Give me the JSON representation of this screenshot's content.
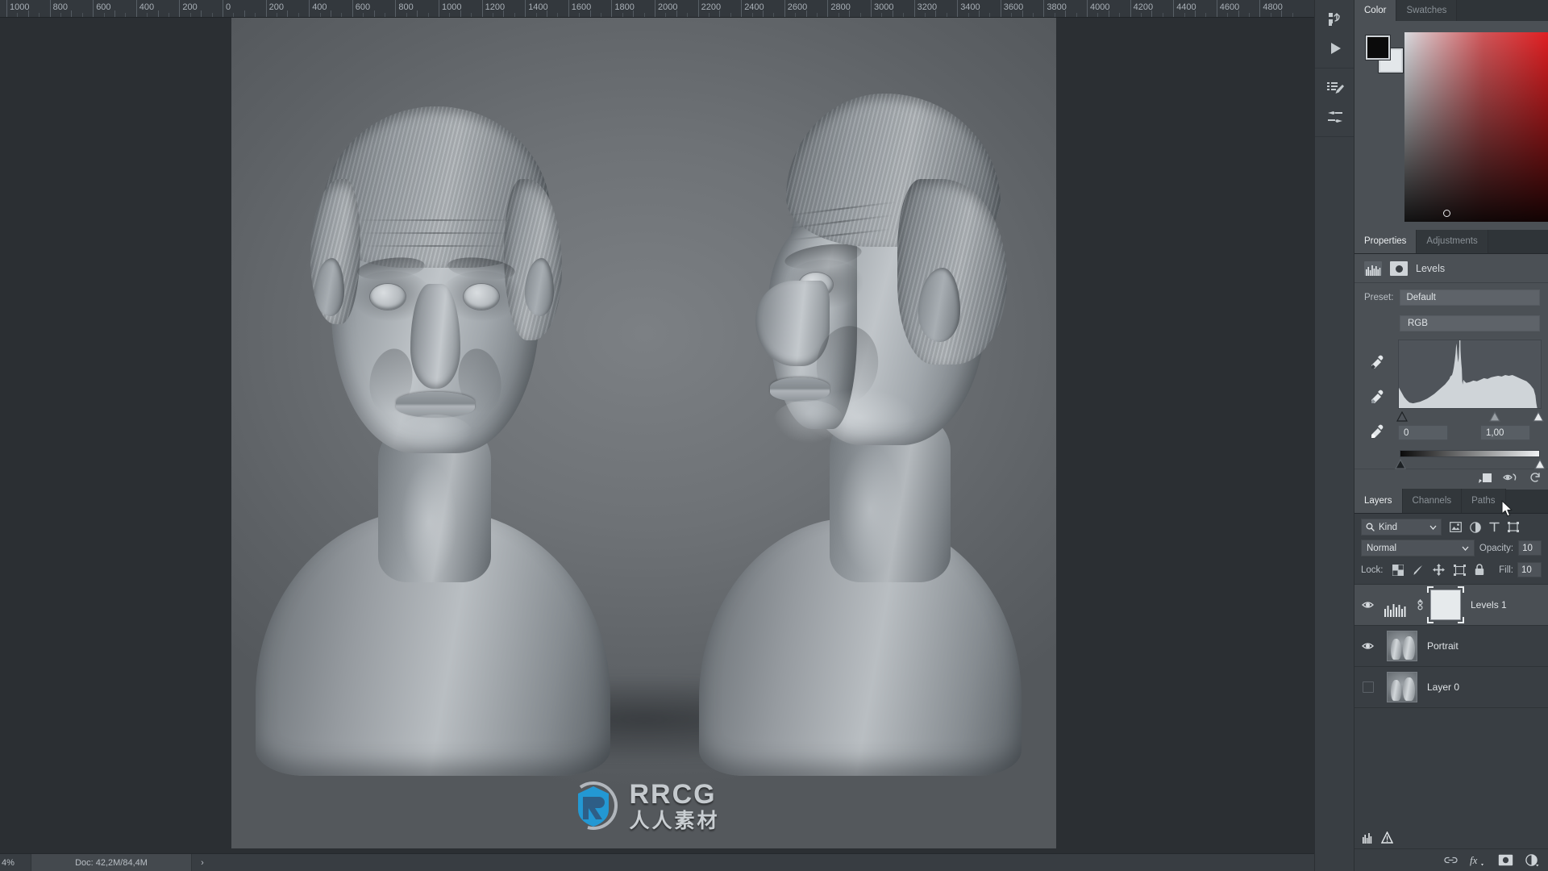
{
  "ruler": {
    "unit_step": 200,
    "labels": [
      "1000",
      "800",
      "600",
      "400",
      "200",
      "0",
      "200",
      "400",
      "600",
      "800",
      "1000",
      "1200",
      "1400",
      "1600",
      "1800",
      "2000",
      "2200",
      "2400",
      "2600",
      "2800",
      "3000",
      "3200",
      "3400",
      "3600",
      "3800",
      "4000",
      "4200",
      "4400",
      "4600",
      "4800"
    ]
  },
  "statusbar": {
    "zoom": "4%",
    "doc": "Doc: 42,2M/84,4M",
    "arrow": "›"
  },
  "watermark": {
    "main": "RRCG",
    "sub": "人人素材",
    "badge": "rrcg-logo-icon"
  },
  "rail": {
    "items": [
      {
        "name": "history-actions-icon",
        "label": "History / Actions"
      },
      {
        "name": "play-icon",
        "label": "Play"
      },
      {
        "name": "brush-presets-icon",
        "label": "Brush Presets"
      },
      {
        "name": "brush-settings-icon",
        "label": "Brush Settings"
      }
    ]
  },
  "color_panel": {
    "tabs": [
      {
        "label": "Color",
        "active": true
      },
      {
        "label": "Swatches",
        "active": false
      }
    ],
    "foreground": "#0b0b0b",
    "background": "#e3e7ea",
    "ramp_accent": "#e01f22"
  },
  "properties": {
    "tabs": [
      {
        "label": "Properties",
        "active": true
      },
      {
        "label": "Adjustments",
        "active": false
      }
    ],
    "title": "Levels",
    "adjustment_icon": "levels-histogram-icon",
    "mask_icon": "layer-mask-icon",
    "preset_label": "Preset:",
    "preset_value": "Default",
    "channel": "RGB",
    "eyedroppers": [
      {
        "name": "set-black-point-eyedropper"
      },
      {
        "name": "set-gray-point-eyedropper"
      },
      {
        "name": "set-white-point-eyedropper"
      }
    ],
    "input_black": "0",
    "input_gamma": "1,00",
    "input_white": "",
    "footer_icons": [
      {
        "name": "clip-to-layer-icon"
      },
      {
        "name": "toggle-visibility-icon"
      },
      {
        "name": "reset-adjustment-icon"
      }
    ],
    "histogram_peak_position": 0.46
  },
  "layers": {
    "tabs": [
      {
        "label": "Layers",
        "active": true
      },
      {
        "label": "Channels",
        "active": false
      },
      {
        "label": "Paths",
        "active": false
      }
    ],
    "filter_kind": "Kind",
    "filter_icons": [
      {
        "name": "filter-pixel-layers-icon"
      },
      {
        "name": "filter-adjustment-layers-icon"
      },
      {
        "name": "filter-type-layers-icon"
      },
      {
        "name": "filter-shape-layers-icon"
      }
    ],
    "blend_mode": "Normal",
    "opacity_label": "Opacity:",
    "opacity_value": "10",
    "lock_label": "Lock:",
    "lock_icons": [
      {
        "name": "lock-transparent-pixels-icon"
      },
      {
        "name": "lock-image-pixels-icon"
      },
      {
        "name": "lock-position-icon"
      },
      {
        "name": "lock-artboard-nesting-icon"
      },
      {
        "name": "lock-all-icon"
      }
    ],
    "fill_label": "Fill:",
    "fill_value": "10",
    "rows": [
      {
        "name": "Levels 1",
        "visible": true,
        "selected": true,
        "type": "adjustment",
        "has_mask": true,
        "linked": true
      },
      {
        "name": "Portrait",
        "visible": true,
        "selected": false,
        "type": "pixel",
        "has_mask": false,
        "linked": false
      },
      {
        "name": "Layer 0",
        "visible": false,
        "selected": false,
        "type": "pixel",
        "has_mask": false,
        "linked": false
      }
    ],
    "footer_icons": [
      {
        "name": "link-layers-icon"
      },
      {
        "name": "layer-style-fx-icon"
      },
      {
        "name": "add-layer-mask-icon"
      },
      {
        "name": "new-adjustment-layer-icon"
      }
    ]
  },
  "canvas": {
    "title": "Portrait sculpt - two bust views",
    "background_color": "#6a6e72"
  }
}
